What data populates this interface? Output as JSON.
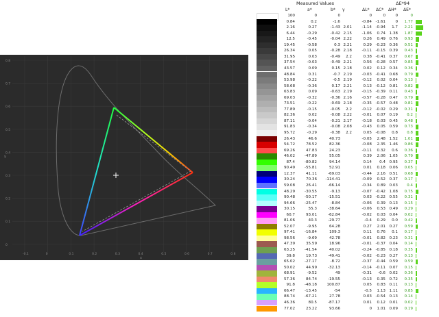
{
  "table": {
    "header_measured": "Measured Values",
    "header_delta": "ΔE*94",
    "columns": [
      "L*",
      "a*",
      "b*",
      "γ",
      "ΔL*",
      "ΔC*",
      "ΔH*",
      "ΔE*"
    ],
    "rows": [
      {
        "color": "#ffffff",
        "L": "100",
        "a": "0",
        "b": "0",
        "g": "",
        "dL": "0",
        "dC": "0",
        "dH": "0",
        "dE": "0",
        "bar": 0
      },
      {
        "color": "#000000",
        "L": "0.84",
        "a": "0.2",
        "b": "-1.6",
        "g": "",
        "dL": "-0.84",
        "dC": "-1.61",
        "dH": "0",
        "dE": "1.77",
        "bar": 1.77
      },
      {
        "color": "#0e0e0e",
        "L": "2.16",
        "a": "0.27",
        "b": "-1.43",
        "g": "2.01",
        "dL": "-1.14",
        "dC": "-0.94",
        "dH": "1.7",
        "dE": "2.21",
        "bar": 2.21
      },
      {
        "color": "#181818",
        "L": "6.44",
        "a": "-0.29",
        "b": "-0.42",
        "g": "2.15",
        "dL": "-1.06",
        "dC": "0.74",
        "dH": "1.38",
        "dE": "1.87",
        "bar": 1.87
      },
      {
        "color": "#232323",
        "L": "12.5",
        "a": "-0.45",
        "b": "-0.04",
        "g": "2.22",
        "dL": "0.26",
        "dC": "0.49",
        "dH": "0.76",
        "dE": "0.93",
        "bar": 0.93
      },
      {
        "color": "#2e2e2e",
        "L": "19.45",
        "a": "-0.58",
        "b": "0.3",
        "g": "2.21",
        "dL": "0.29",
        "dC": "-0.23",
        "dH": "0.36",
        "dE": "0.51",
        "bar": 0.51
      },
      {
        "color": "#3a3a3a",
        "L": "26.34",
        "a": "0.05",
        "b": "-0.28",
        "g": "2.18",
        "dL": "-0.11",
        "dC": "-0.15",
        "dH": "0.39",
        "dE": "0.43",
        "bar": 0.43
      },
      {
        "color": "#474747",
        "L": "31.95",
        "a": "0.03",
        "b": "-0.49",
        "g": "2.2",
        "dL": "0.38",
        "dC": "-0.41",
        "dH": "0.37",
        "dE": "0.67",
        "bar": 0.67
      },
      {
        "color": "#545454",
        "L": "37.54",
        "a": "-0.03",
        "b": "-0.49",
        "g": "2.21",
        "dL": "0.56",
        "dC": "-0.28",
        "dH": "0.57",
        "dE": "0.85",
        "bar": 0.85
      },
      {
        "color": "#616161",
        "L": "43.57",
        "a": "0.09",
        "b": "0.15",
        "g": "2.18",
        "dL": "0.02",
        "dC": "0.12",
        "dH": "0.34",
        "dE": "0.36",
        "bar": 0.36
      },
      {
        "color": "#6e6e6e",
        "L": "48.84",
        "a": "0.31",
        "b": "-0.7",
        "g": "2.19",
        "dL": "-0.03",
        "dC": "-0.41",
        "dH": "0.68",
        "dE": "0.79",
        "bar": 0.79
      },
      {
        "color": "#7b7b7b",
        "L": "53.98",
        "a": "-0.22",
        "b": "-0.5",
        "g": "2.19",
        "dL": "-0.12",
        "dC": "0.02",
        "dH": "0.04",
        "dE": "0.13",
        "bar": 0.13
      },
      {
        "color": "#888888",
        "L": "58.68",
        "a": "-0.36",
        "b": "0.17",
        "g": "2.21",
        "dL": "0.13",
        "dC": "-0.12",
        "dH": "0.81",
        "dE": "0.82",
        "bar": 0.82
      },
      {
        "color": "#959595",
        "L": "63.83",
        "a": "0.09",
        "b": "-0.63",
        "g": "2.19",
        "dL": "-0.15",
        "dC": "-0.39",
        "dH": "0.11",
        "dE": "0.43",
        "bar": 0.43
      },
      {
        "color": "#a2a2a2",
        "L": "69.03",
        "a": "-0.32",
        "b": "-0.36",
        "g": "2.16",
        "dL": "-0.57",
        "dC": "-0.28",
        "dH": "0.47",
        "dE": "0.79",
        "bar": 0.79
      },
      {
        "color": "#afafaf",
        "L": "73.51",
        "a": "-0.22",
        "b": "-0.69",
        "g": "2.18",
        "dL": "-0.35",
        "dC": "-0.57",
        "dH": "0.48",
        "dE": "0.81",
        "bar": 0.81
      },
      {
        "color": "#bcbcbc",
        "L": "77.89",
        "a": "-0.15",
        "b": "-0.05",
        "g": "2.2",
        "dL": "-0.12",
        "dC": "-0.02",
        "dH": "0.29",
        "dE": "0.31",
        "bar": 0.31
      },
      {
        "color": "#c9c9c9",
        "L": "82.36",
        "a": "0.02",
        "b": "-0.08",
        "g": "2.22",
        "dL": "-0.01",
        "dC": "0.07",
        "dH": "0.19",
        "dE": "0.2",
        "bar": 0.2
      },
      {
        "color": "#d6d6d6",
        "L": "87.11",
        "a": "-0.04",
        "b": "-0.21",
        "g": "2.17",
        "dL": "-0.18",
        "dC": "0.03",
        "dH": "0.45",
        "dE": "0.48",
        "bar": 0.48
      },
      {
        "color": "#e3e3e3",
        "L": "91.83",
        "a": "-0.34",
        "b": "-0.08",
        "g": "2.08",
        "dL": "-0.43",
        "dC": "0.05",
        "dH": "0.59",
        "dE": "0.73",
        "bar": 0.73
      },
      {
        "color": "#f0f0f0",
        "L": "95.72",
        "a": "-0.29",
        "b": "-0.38",
        "g": "2.2",
        "dL": "0.05",
        "dC": "-0.08",
        "dH": "0.8",
        "dE": "0.8",
        "bar": 0.8
      },
      {
        "color": "#7a0000",
        "L": "26.43",
        "a": "46.6",
        "b": "40.73",
        "g": "",
        "dL": "-0.05",
        "dC": "2.48",
        "dH": "1.52",
        "dE": "1.01",
        "bar": 1.01
      },
      {
        "color": "#d80000",
        "L": "54.72",
        "a": "78.52",
        "b": "82.36",
        "g": "",
        "dL": "-0.08",
        "dC": "2.35",
        "dH": "1.46",
        "dE": "0.86",
        "bar": 0.86
      },
      {
        "color": "#ff4c4c",
        "L": "69.26",
        "a": "47.83",
        "b": "24.23",
        "g": "",
        "dL": "-0.11",
        "dC": "0.32",
        "dH": "0.6",
        "dE": "0.36",
        "bar": 0.36
      },
      {
        "color": "#2a8a00",
        "L": "46.02",
        "a": "-47.89",
        "b": "55.05",
        "g": "",
        "dL": "0.39",
        "dC": "2.06",
        "dH": "1.05",
        "dE": "0.79",
        "bar": 0.79
      },
      {
        "color": "#33ff00",
        "L": "87.4",
        "a": "-80.82",
        "b": "94.14",
        "g": "",
        "dL": "0.14",
        "dC": "0.4",
        "dH": "0.95",
        "dE": "0.37",
        "bar": 0.37
      },
      {
        "color": "#7dff66",
        "L": "90.49",
        "a": "-55.81",
        "b": "52.91",
        "g": "",
        "dL": "0.01",
        "dC": "0.18",
        "dH": "0.06",
        "dE": "0.05",
        "bar": 0.05
      },
      {
        "color": "#000078",
        "L": "12.37",
        "a": "41.11",
        "b": "-69.03",
        "g": "",
        "dL": "-0.44",
        "dC": "2.16",
        "dH": "0.51",
        "dE": "0.68",
        "bar": 0.68
      },
      {
        "color": "#0000ff",
        "L": "30.24",
        "a": "70.36",
        "b": "-114.41",
        "g": "",
        "dL": "-0.09",
        "dC": "0.52",
        "dH": "0.37",
        "dE": "0.17",
        "bar": 0.17
      },
      {
        "color": "#5f72ff",
        "L": "59.08",
        "a": "26.41",
        "b": "-66.14",
        "g": "",
        "dL": "-0.34",
        "dC": "0.89",
        "dH": "0.03",
        "dE": "0.4",
        "bar": 0.4
      },
      {
        "color": "#00ffe4",
        "L": "48.29",
        "a": "-30.55",
        "b": "-9.13",
        "g": "",
        "dL": "-0.07",
        "dC": "-0.42",
        "dH": "1.08",
        "dE": "0.75",
        "bar": 0.75
      },
      {
        "color": "#59fff7",
        "L": "90.48",
        "a": "-50.17",
        "b": "-15.51",
        "g": "",
        "dL": "0.03",
        "dC": "-0.22",
        "dH": "0.55",
        "dE": "0.31",
        "bar": 0.31
      },
      {
        "color": "#b4ffff",
        "L": "94.66",
        "a": "-25.47",
        "b": "-8.84",
        "g": "",
        "dL": "-0.06",
        "dC": "0.39",
        "dH": "0.13",
        "dE": "0.15",
        "bar": 0.15
      },
      {
        "color": "#7a0090",
        "L": "30.15",
        "a": "55.3",
        "b": "-38.64",
        "g": "",
        "dL": "-0.06",
        "dC": "0.53",
        "dH": "0.49",
        "dE": "0.29",
        "bar": 0.29
      },
      {
        "color": "#ff00ff",
        "L": "60.7",
        "a": "93.01",
        "b": "-62.84",
        "g": "",
        "dL": "-0.02",
        "dC": "0.03",
        "dH": "0.04",
        "dE": "0.02",
        "bar": 0.02
      },
      {
        "color": "#ff9cf6",
        "L": "81.06",
        "a": "40.3",
        "b": "-29.77",
        "g": "",
        "dL": "-0.4",
        "dC": "0.29",
        "dH": "0.0",
        "dE": "0.42",
        "bar": 0.42
      },
      {
        "color": "#8f7d00",
        "L": "52.07",
        "a": "-9.95",
        "b": "64.28",
        "g": "",
        "dL": "0.27",
        "dC": "2.01",
        "dH": "0.27",
        "dE": "0.59",
        "bar": 0.59
      },
      {
        "color": "#f2ff00",
        "L": "97.41",
        "a": "-16.84",
        "b": "109.3",
        "g": "",
        "dL": "0.11",
        "dC": "0.76",
        "dH": "0.1",
        "dE": "0.17",
        "bar": 0.17
      },
      {
        "color": "#ffff99",
        "L": "98.56",
        "a": "-9.69",
        "b": "42.78",
        "g": "",
        "dL": "-0.01",
        "dC": "0.82",
        "dH": "0.23",
        "dE": "0.31",
        "bar": 0.31
      },
      {
        "color": "#9c5a50",
        "L": "47.39",
        "a": "35.59",
        "b": "18.96",
        "g": "",
        "dL": "-0.01",
        "dC": "-0.37",
        "dH": "0.04",
        "dE": "0.14",
        "bar": 0.14
      },
      {
        "color": "#6fa050",
        "L": "63.25",
        "a": "-41.54",
        "b": "40.02",
        "g": "",
        "dL": "-0.24",
        "dC": "-0.85",
        "dH": "0.18",
        "dE": "0.35",
        "bar": 0.35
      },
      {
        "color": "#5569b4",
        "L": "39.8",
        "a": "19.73",
        "b": "-49.41",
        "g": "",
        "dL": "-0.02",
        "dC": "-0.23",
        "dH": "0.27",
        "dE": "0.13",
        "bar": 0.13
      },
      {
        "color": "#6aa0a0",
        "L": "65.02",
        "a": "-27.17",
        "b": "-8.72",
        "g": "",
        "dL": "-0.37",
        "dC": "-0.44",
        "dH": "0.59",
        "dE": "0.59",
        "bar": 0.59
      },
      {
        "color": "#b450b4",
        "L": "50.02",
        "a": "44.99",
        "b": "-32.13",
        "g": "",
        "dL": "-0.14",
        "dC": "-0.11",
        "dH": "0.07",
        "dE": "0.15",
        "bar": 0.15
      },
      {
        "color": "#a0b43c",
        "L": "68.91",
        "a": "-9.52",
        "b": "49",
        "g": "",
        "dL": "-0.31",
        "dC": "-0.6",
        "dH": "0.02",
        "dE": "0.36",
        "bar": 0.36
      },
      {
        "color": "#f08a6e",
        "L": "57.36",
        "a": "84.74",
        "b": "-19.55",
        "g": "",
        "dL": "-0.13",
        "dC": "0.35",
        "dH": "0.72",
        "dE": "0.35",
        "bar": 0.35
      },
      {
        "color": "#b4ff28",
        "L": "91.8",
        "a": "-48.18",
        "b": "100.87",
        "g": "",
        "dL": "0.05",
        "dC": "0.83",
        "dH": "0.11",
        "dE": "0.13",
        "bar": 0.13
      },
      {
        "color": "#28b4ff",
        "L": "66.47",
        "a": "-13.45",
        "b": "-54",
        "g": "",
        "dL": "-0.5",
        "dC": "1.13",
        "dH": "1.11",
        "dE": "0.85",
        "bar": 0.85
      },
      {
        "color": "#6affb4",
        "L": "88.74",
        "a": "-67.21",
        "b": "27.78",
        "g": "",
        "dL": "0.03",
        "dC": "-0.54",
        "dH": "0.13",
        "dE": "0.14",
        "bar": 0.14
      },
      {
        "color": "#d8a0ff",
        "L": "46.36",
        "a": "80.5",
        "b": "-87.17",
        "g": "",
        "dL": "0.01",
        "dC": "0.12",
        "dH": "0.01",
        "dE": "0.02",
        "bar": 0.02
      },
      {
        "color": "#ff9800",
        "L": "77.02",
        "a": "23.22",
        "b": "93.66",
        "g": "",
        "dL": "0",
        "dC": "1.01",
        "dH": "0.09",
        "dE": "0.19",
        "bar": 0.19
      }
    ]
  },
  "cie": {
    "xticks": [
      "-0.1",
      "0",
      "0.1",
      "0.2",
      "0.3",
      "0.4",
      "0.5",
      "0.6",
      "0.7",
      "0.8"
    ],
    "yticks": [
      "0.8",
      "0.7",
      "0.6",
      "0.5",
      "0.4",
      "0.3",
      "0.2",
      "0.1",
      "0",
      "-0.1"
    ],
    "xlabel": "x",
    "ylabel": "y",
    "background": "#2b2b2b"
  }
}
